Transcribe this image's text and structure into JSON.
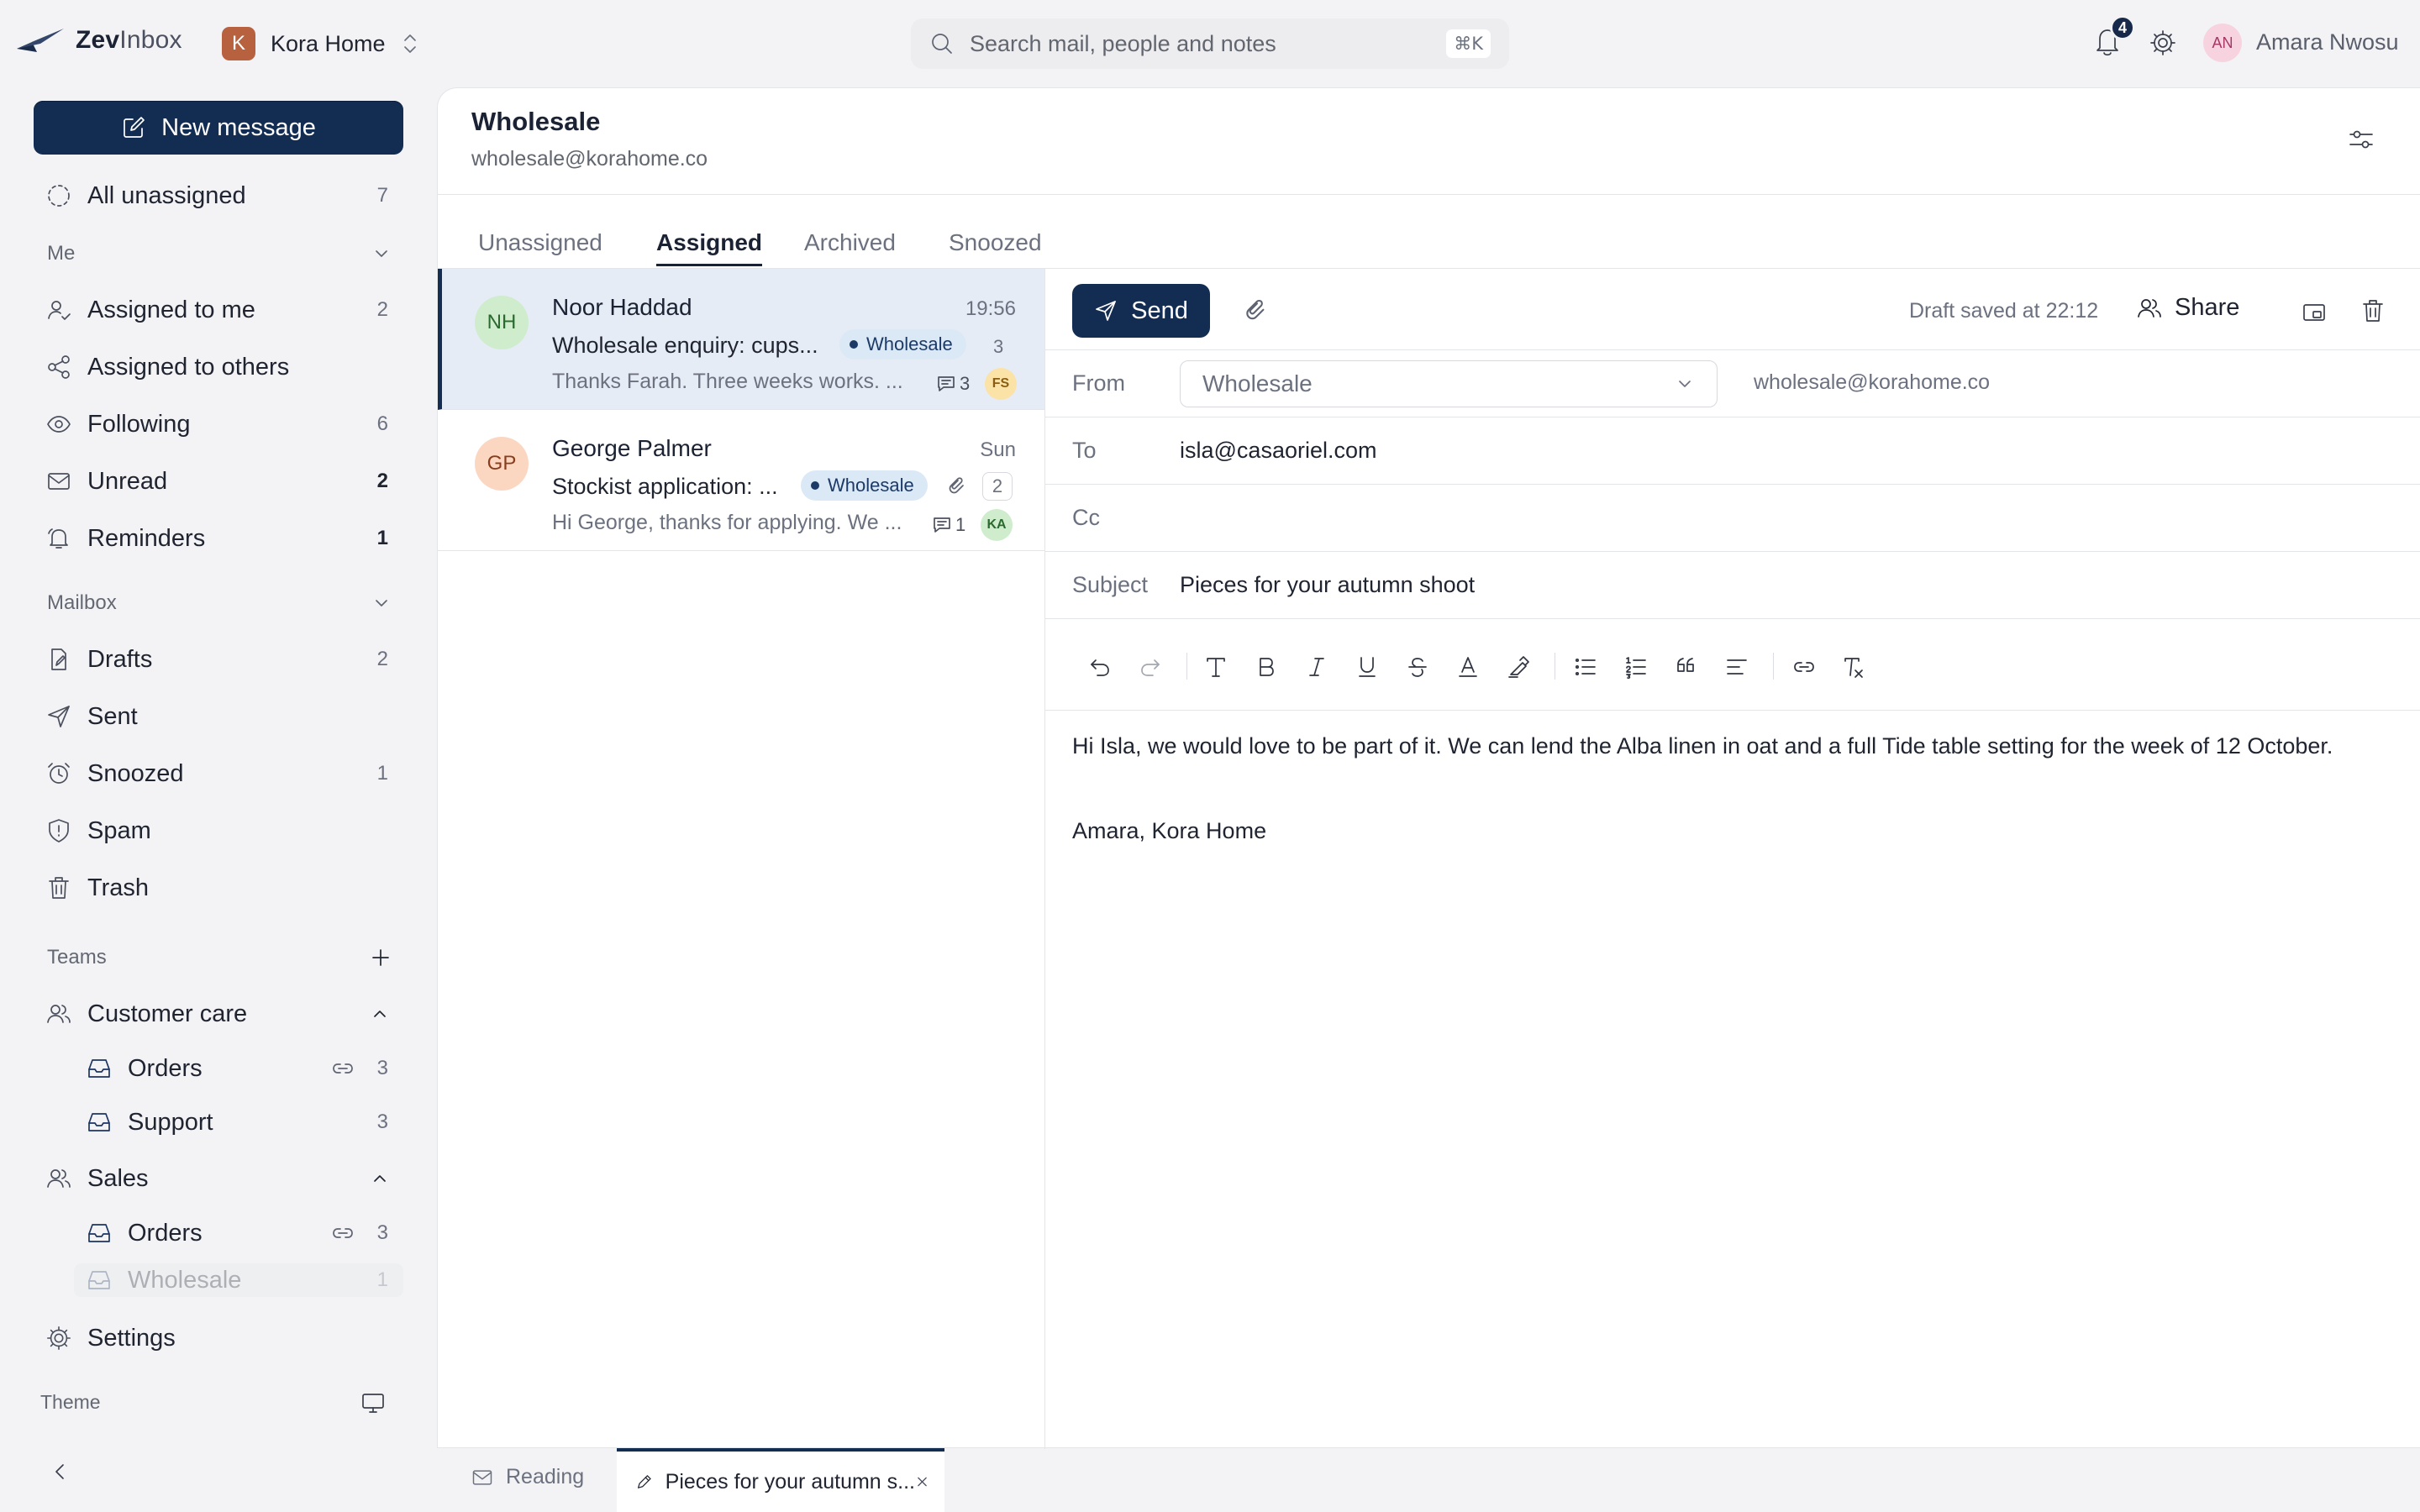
{
  "app": {
    "logo_bold": "Zev",
    "logo_light": "Inbox",
    "workspace_initial": "K",
    "workspace_name": "Kora Home"
  },
  "search": {
    "placeholder": "Search mail, people and notes",
    "shortcut": "⌘K"
  },
  "header": {
    "notification_count": "4",
    "user_initials": "AN",
    "user_name": "Amara Nwosu"
  },
  "sidebar": {
    "new_message_label": "New message",
    "all_unassigned": {
      "label": "All unassigned",
      "count": "7"
    },
    "me_section": "Me",
    "me_items": [
      {
        "label": "Assigned to me",
        "count": "2"
      },
      {
        "label": "Assigned to others",
        "count": ""
      },
      {
        "label": "Following",
        "count": "6"
      },
      {
        "label": "Unread",
        "count": "2"
      },
      {
        "label": "Reminders",
        "count": "1"
      }
    ],
    "mailbox_section": "Mailbox",
    "mailbox_items": [
      {
        "label": "Drafts",
        "count": "2"
      },
      {
        "label": "Sent",
        "count": ""
      },
      {
        "label": "Snoozed",
        "count": "1"
      },
      {
        "label": "Spam",
        "count": ""
      },
      {
        "label": "Trash",
        "count": ""
      }
    ],
    "teams_section": "Teams",
    "teams": [
      {
        "label": "Customer care",
        "inboxes": [
          {
            "label": "Orders",
            "count": "3"
          },
          {
            "label": "Support",
            "count": "3"
          }
        ]
      },
      {
        "label": "Sales",
        "inboxes": [
          {
            "label": "Orders",
            "count": "3"
          },
          {
            "label": "Wholesale",
            "count": "1"
          }
        ]
      }
    ],
    "settings_label": "Settings",
    "theme_label": "Theme"
  },
  "mailbox": {
    "title": "Wholesale",
    "email": "wholesale@korahome.co",
    "tabs": [
      "Unassigned",
      "Assigned",
      "Archived",
      "Snoozed"
    ],
    "active_tab": "Assigned"
  },
  "conversations": [
    {
      "initials": "NH",
      "name": "Noor Haddad",
      "time": "19:56",
      "subject": "Wholesale enquiry: cups...",
      "tag": "Wholesale",
      "message_count": "3",
      "preview": "Thanks Farah. Three weeks works. ...",
      "notes": "3",
      "assignee": "FS",
      "selected": true
    },
    {
      "initials": "GP",
      "name": "George Palmer",
      "time": "Sun",
      "subject": "Stockist application: ...",
      "tag": "Wholesale",
      "message_count": "2",
      "preview": "Hi George, thanks for applying. We ...",
      "notes": "1",
      "assignee": "KA",
      "selected": false
    }
  ],
  "compose": {
    "send_label": "Send",
    "draft_status": "Draft saved at 22:12",
    "share_label": "Share",
    "from_label": "From",
    "from_value": "Wholesale",
    "from_email": "wholesale@korahome.co",
    "to_label": "To",
    "to_value": "isla@casaoriel.com",
    "cc_label": "Cc",
    "cc_value": "",
    "subject_label": "Subject",
    "subject_value": "Pieces for your autumn shoot",
    "body": "Hi Isla, we would love to be part of it. We can lend the Alba linen in oat and a full Tide table setting for the week of 12 October.",
    "signature": "Amara, Kora Home",
    "toolbar_icons": [
      "undo-icon",
      "redo-icon",
      "text-icon",
      "bold-icon",
      "italic-icon",
      "underline-icon",
      "strikethrough-icon",
      "text-color-icon",
      "highlight-icon",
      "bullet-list-icon",
      "numbered-list-icon",
      "quote-icon",
      "align-icon",
      "link-icon",
      "clear-format-icon"
    ]
  },
  "bottom_tabs": {
    "reading_label": "Reading",
    "draft_label": "Pieces for your autumn s..."
  },
  "colors": {
    "primary": "#132d52",
    "selected_row": "#e6ecf5",
    "tag_bg": "#dbe8f6",
    "workspace_avatar": "#b8613f",
    "user_avatar": "#f7d3e0"
  }
}
